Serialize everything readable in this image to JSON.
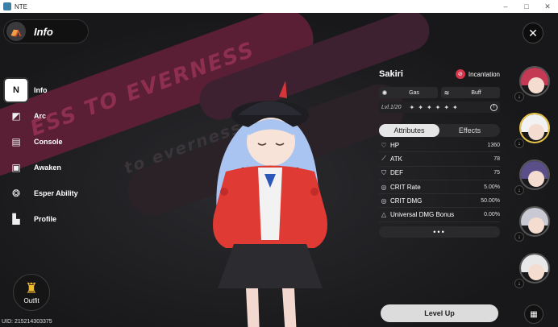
{
  "window": {
    "title": "NTE",
    "minimize": "–",
    "maximize": "□",
    "close": "✕"
  },
  "header": {
    "title": "Info",
    "logo_icon": "tent-icon",
    "close_icon": "✕"
  },
  "background_text": {
    "line1": "ESS TO EVERNESS",
    "line2": "to everness"
  },
  "menu": [
    {
      "label": "Info",
      "icon": "info-icon",
      "glyph": "N",
      "active": true
    },
    {
      "label": "Arc",
      "icon": "arc-icon",
      "glyph": "◩",
      "active": false
    },
    {
      "label": "Console",
      "icon": "console-icon",
      "glyph": "▤",
      "active": false
    },
    {
      "label": "Awaken",
      "icon": "awaken-icon",
      "glyph": "▣",
      "active": false
    },
    {
      "label": "Esper Ability",
      "icon": "esper-icon",
      "glyph": "❂",
      "active": false
    },
    {
      "label": "Profile",
      "icon": "profile-icon",
      "glyph": "▙",
      "active": false
    }
  ],
  "outfit": {
    "label": "Outfit",
    "glyph": "♜"
  },
  "uid": "UID: 215214303375",
  "character": {
    "name": "Sakiri",
    "class": "Incantation",
    "tags": [
      {
        "label": "Gas",
        "glyph": "✺"
      },
      {
        "label": "Buff",
        "glyph": "≋"
      }
    ],
    "level": "Lvl.1/20",
    "stars": [
      "✦",
      "✦",
      "✦",
      "✦",
      "✦",
      "✦"
    ],
    "info_glyph": "!"
  },
  "tabs": [
    {
      "label": "Attributes",
      "active": true
    },
    {
      "label": "Effects",
      "active": false
    }
  ],
  "stats": [
    {
      "name": "HP",
      "value": "1360",
      "glyph": "♡"
    },
    {
      "name": "ATK",
      "value": "78",
      "glyph": "⟋"
    },
    {
      "name": "DEF",
      "value": "75",
      "glyph": "⛉"
    },
    {
      "name": "CRIT Rate",
      "value": "5.00%",
      "glyph": "◎"
    },
    {
      "name": "CRIT DMG",
      "value": "50.00%",
      "glyph": "◎"
    },
    {
      "name": "Universal DMG Bonus",
      "value": "0.00%",
      "glyph": "△"
    }
  ],
  "more_label": "•••",
  "level_up_label": "Level Up",
  "roster": [
    {
      "name": "avatar-1",
      "hair": "#c43a55",
      "selected": false
    },
    {
      "name": "avatar-2",
      "hair": "#f2f2f2",
      "selected": true
    },
    {
      "name": "avatar-3",
      "hair": "#5a4f88",
      "selected": false
    },
    {
      "name": "avatar-4",
      "hair": "#c9c9d3",
      "selected": false
    },
    {
      "name": "avatar-5",
      "hair": "#e8e8e8",
      "selected": false
    }
  ],
  "roster_arrow": "↓",
  "grid_glyph": "▦",
  "colors": {
    "accent": "#e8c547",
    "stripe": "#5a1f34",
    "class_badge": "#d6354b",
    "jacket": "#e03a34"
  }
}
